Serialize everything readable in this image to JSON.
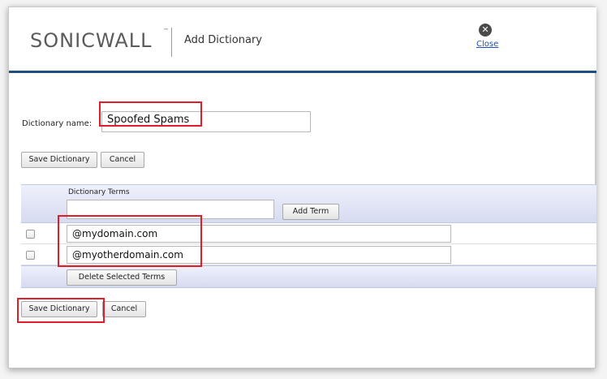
{
  "header": {
    "logo_text": "SONICWALL",
    "logo_tm": "™",
    "title": "Add Dictionary",
    "close_label": "Close",
    "close_icon_glyph": "✕"
  },
  "form": {
    "dictionary_name_label": "Dictionary name:",
    "dictionary_name_value": "Spoofed Spams",
    "save_label": "Save Dictionary",
    "cancel_label": "Cancel"
  },
  "terms_table": {
    "column_header": "Dictionary Terms",
    "new_term_value": "",
    "add_term_label": "Add Term",
    "rows": [
      {
        "checked": false,
        "term": "@mydomain.com"
      },
      {
        "checked": false,
        "term": "@myotherdomain.com"
      }
    ],
    "delete_label": "Delete Selected Terms"
  },
  "colors": {
    "accent_rule": "#1f4f80",
    "highlight": "#e01e2b",
    "link": "#1a4fb5",
    "table_bar": "#d7dbf0"
  }
}
